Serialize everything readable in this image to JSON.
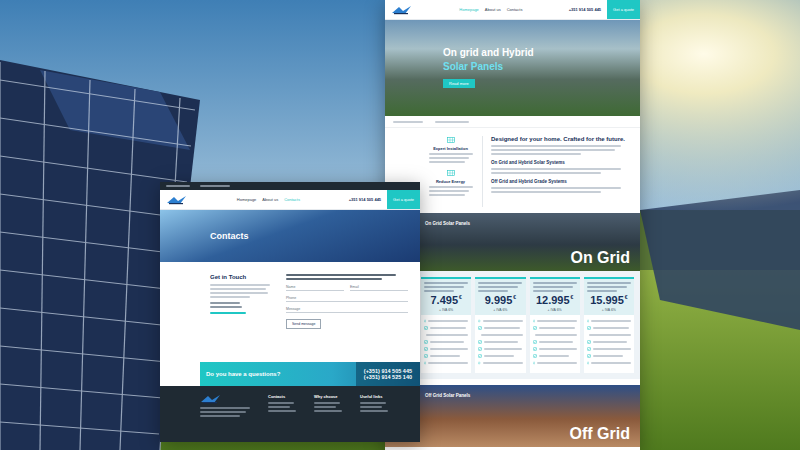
{
  "home_page": {
    "nav": {
      "links": [
        {
          "label": "Homepage",
          "selected": true
        },
        {
          "label": "About us",
          "selected": false
        },
        {
          "label": "Contacts",
          "selected": false
        }
      ],
      "phone": "+351 914 505 445",
      "button": "Get a quote"
    },
    "hero": {
      "title": "On grid and Hybrid",
      "title_accent": "Solar Panels",
      "button": "Read more"
    },
    "features": [
      {
        "title": "Expert Installation"
      },
      {
        "title": "Reduce Energy"
      }
    ],
    "intro": {
      "title": "Designed for your home. Crafted for the future.",
      "sections": [
        "On Grid and Hybrid Solar Systems",
        "Off Grid and Hybrid Grade Systems"
      ]
    },
    "on_grid": {
      "caption": "On Grid Solar Panels",
      "title": "On Grid"
    },
    "plans": [
      {
        "price": "7.495",
        "currency": "€",
        "note": "+ IVA 6%"
      },
      {
        "price": "9.995",
        "currency": "€",
        "note": "+ IVA 6%"
      },
      {
        "price": "12.995",
        "currency": "€",
        "note": "+ IVA 6%"
      },
      {
        "price": "15.995",
        "currency": "€",
        "note": "+ IVA 6%"
      }
    ],
    "off_grid": {
      "caption": "Off Grid Solar Panels",
      "title": "Off Grid"
    }
  },
  "contact_page": {
    "nav": {
      "links": [
        {
          "label": "Homepage",
          "selected": false
        },
        {
          "label": "About us",
          "selected": false
        },
        {
          "label": "Contacts",
          "selected": true
        }
      ],
      "phone": "+351 914 505 445",
      "button": "Get a quote"
    },
    "hero": {
      "title": "Contacts"
    },
    "get_in_touch": {
      "title": "Get in Touch"
    },
    "form": {
      "fields": [
        "Name",
        "Email",
        "Phone",
        "Message"
      ],
      "button": "Send message"
    },
    "banner": {
      "title": "Do you have a questions?",
      "phones": [
        "(+351) 914 505 445",
        "(+351) 914 525 140"
      ]
    },
    "footer": {
      "columns": [
        "Contacts",
        "Why choose",
        "Useful links"
      ]
    }
  }
}
